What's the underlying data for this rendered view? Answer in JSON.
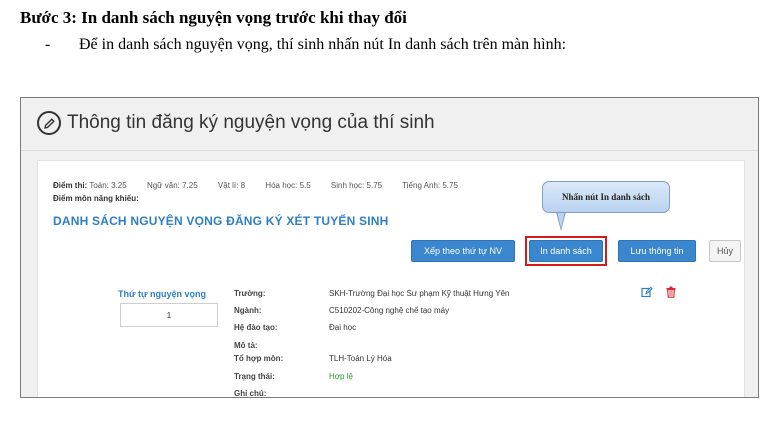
{
  "doc": {
    "heading": "Bước 3: In danh sách nguyện vọng trước khi thay đổi",
    "bullet_dash": "-",
    "bullet_text": "Để in danh sách nguyện vọng, thí sinh nhấn nút In danh sách trên màn hình:"
  },
  "screen": {
    "title": "Thông tin đăng ký nguyện vọng của thí sinh",
    "scores_label": "Điểm thi:",
    "scores": [
      {
        "subject": "Toán:",
        "value": "3.25"
      },
      {
        "subject": "Ngữ văn:",
        "value": "7.25"
      },
      {
        "subject": "Vật lí:",
        "value": "8"
      },
      {
        "subject": "Hóa học:",
        "value": "5.5"
      },
      {
        "subject": "Sinh học:",
        "value": "5.75"
      },
      {
        "subject": "Tiếng Anh:",
        "value": "5.75"
      }
    ],
    "talent_label": "Điểm môn năng khiếu:",
    "list_title": "DANH SÁCH NGUYỆN VỌNG ĐĂNG KÝ XÉT TUYỂN SINH",
    "callout": "Nhấn nút In danh sách",
    "buttons": {
      "sort": "Xếp theo thứ tự NV",
      "print": "In danh sách",
      "save": "Lưu thông tin",
      "cancel": "Hủy"
    },
    "order_label": "Thứ tự nguyện vọng",
    "order_value": "1",
    "fields": [
      {
        "label": "Trường:",
        "value": "SKH-Trường Đại học Sư phạm Kỹ thuật Hưng Yên"
      },
      {
        "label": "Ngành:",
        "value": "C510202-Công nghệ chế tạo máy"
      },
      {
        "label": "Hệ đào tạo:",
        "value": "Đại học"
      },
      {
        "label": "Mô tả:",
        "value": ""
      },
      {
        "label": "Tổ hợp môn:",
        "value": "TLH-Toán Lý Hóa"
      },
      {
        "label": "Trạng thái:",
        "value": "Hợp lệ"
      },
      {
        "label": "Ghi chú:",
        "value": ""
      }
    ],
    "colors": {
      "accent": "#2f7fc1",
      "button": "#3a87d0",
      "highlight": "#d01c1c",
      "status_ok": "#2a9d2a",
      "trash": "#d9262b"
    },
    "icons": [
      "edit-circle-icon",
      "edit-icon",
      "trash-icon"
    ]
  }
}
